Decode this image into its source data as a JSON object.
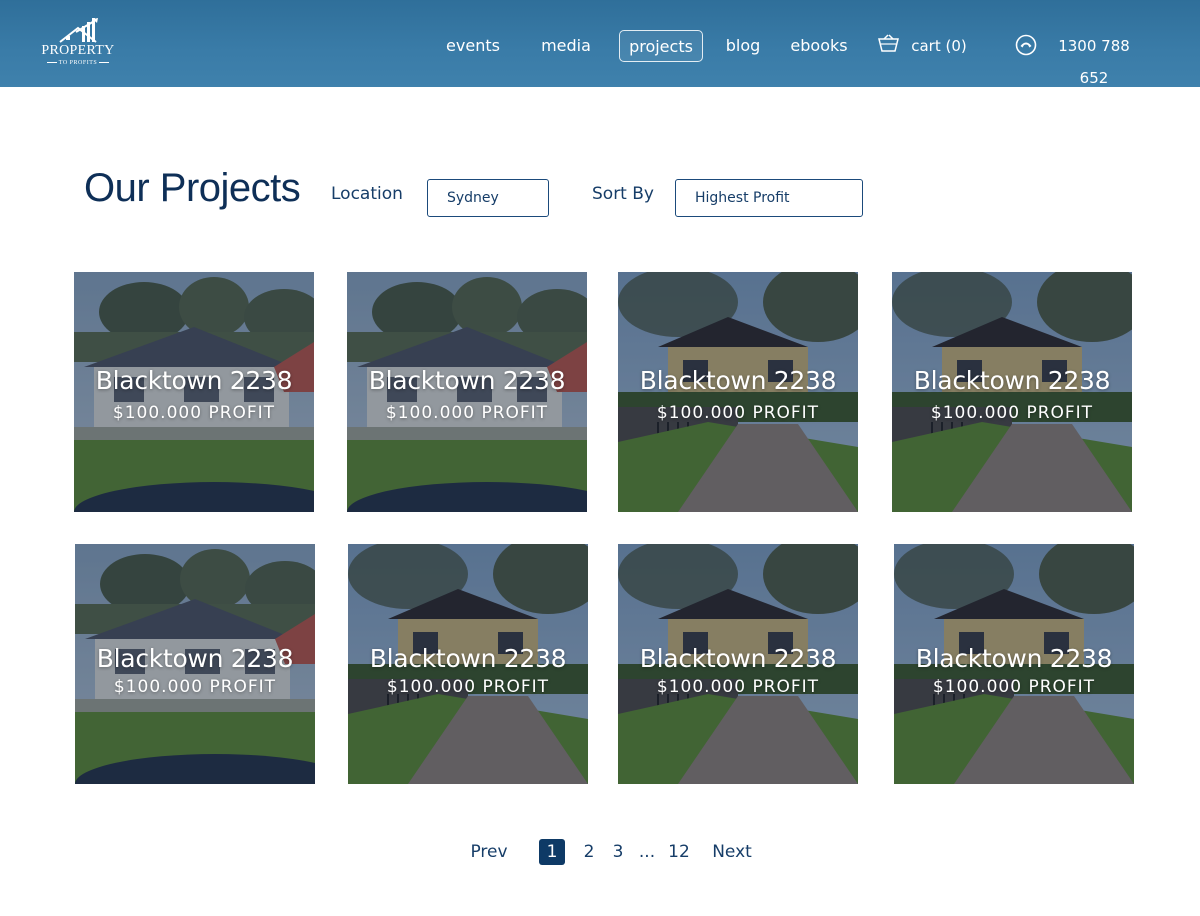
{
  "brand": {
    "name": "PROPERTY",
    "tagline": "TO PROFITS"
  },
  "nav": {
    "events": "events",
    "media": "media",
    "projects": "projects",
    "blog": "blog",
    "ebooks": "ebooks",
    "cart": "cart (0)",
    "phone": "1300 788 652"
  },
  "main": {
    "title": "Our Projects",
    "location_label": "Location",
    "location_value": "Sydney",
    "sort_label": "Sort By",
    "sort_value": "Highest Profit"
  },
  "projects": [
    {
      "title": "Blacktown 2238",
      "profit": "$100.000 PROFIT",
      "photo": "house-white"
    },
    {
      "title": "Blacktown 2238",
      "profit": "$100.000 PROFIT",
      "photo": "house-white"
    },
    {
      "title": "Blacktown 2238",
      "profit": "$100.000 PROFIT",
      "photo": "house-driveway"
    },
    {
      "title": "Blacktown 2238",
      "profit": "$100.000 PROFIT",
      "photo": "house-driveway"
    },
    {
      "title": "Blacktown 2238",
      "profit": "$100.000 PROFIT",
      "photo": "house-white"
    },
    {
      "title": "Blacktown 2238",
      "profit": "$100.000 PROFIT",
      "photo": "house-driveway"
    },
    {
      "title": "Blacktown 2238",
      "profit": "$100.000 PROFIT",
      "photo": "house-driveway"
    },
    {
      "title": "Blacktown 2238",
      "profit": "$100.000 PROFIT",
      "photo": "house-driveway"
    }
  ],
  "pagination": {
    "prev": "Prev",
    "pages": [
      "1",
      "2",
      "3",
      "...",
      "12"
    ],
    "current": "1",
    "next": "Next"
  },
  "colors": {
    "header": "#3a7ca8",
    "heading": "#0e2f57",
    "accent": "#0e3a66"
  }
}
